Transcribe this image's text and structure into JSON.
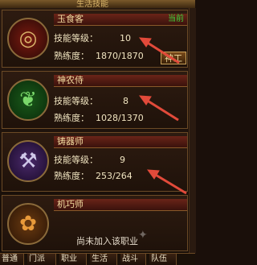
{
  "title": "生活技能",
  "professions": [
    {
      "name": "玉食客",
      "status": "当前",
      "level_label": "技能等级：",
      "level": "10",
      "exp_label": "熟练度：",
      "exp": "1870/1870",
      "button": "神工",
      "icon": "bowl-icon"
    },
    {
      "name": "神农侍",
      "level_label": "技能等级：",
      "level": "8",
      "exp_label": "熟练度：",
      "exp": "1028/1370",
      "icon": "herb-icon"
    },
    {
      "name": "铸器师",
      "level_label": "技能等级：",
      "level": "9",
      "exp_label": "熟练度：",
      "exp": "253/264",
      "icon": "anvil-icon"
    },
    {
      "name": "机巧师",
      "notice": "尚未加入该职业",
      "icon": "gear-icon"
    }
  ],
  "tabs": [
    "普通",
    "门派",
    "职业",
    "生活",
    "战斗",
    "队伍"
  ],
  "colors": {
    "accent": "#f3c35a",
    "current": "#3bd33b",
    "arrow": "#e24a3a"
  }
}
